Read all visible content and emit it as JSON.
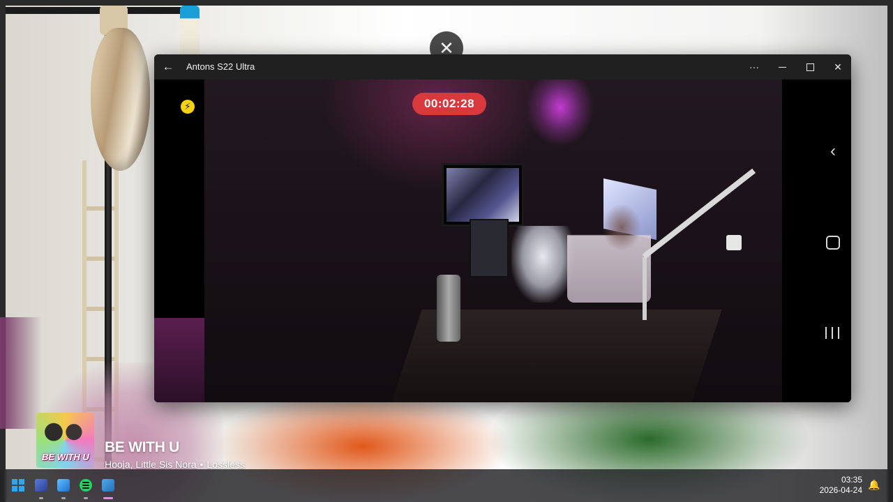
{
  "window": {
    "title": "Antons S22 Ultra",
    "back_glyph": "←",
    "more_glyph": "···",
    "close_glyph": "✕"
  },
  "overlay": {
    "close_glyph": "✕"
  },
  "camera": {
    "timer": "00:02:28",
    "flash_glyph": "⚡",
    "record_color": "#d9383c"
  },
  "android_nav": {
    "back_glyph": "‹"
  },
  "now_playing": {
    "album_text": "BE WITH U",
    "title": "BE WITH U",
    "artists": "Hooja, Little Sis Nora",
    "separator": "•",
    "quality": "Lossless"
  },
  "taskbar": {
    "icons": [
      "windows-start-icon",
      "media-player-icon",
      "photos-icon",
      "spotify-icon",
      "app-window-icon"
    ],
    "time": "03:35",
    "date": "2026-04-24",
    "notification_glyph": "🔔"
  }
}
